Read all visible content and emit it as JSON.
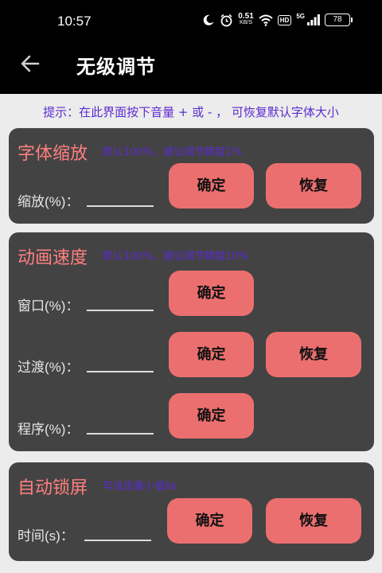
{
  "statusbar": {
    "time": "10:57",
    "net_speed_value": "0.51",
    "net_speed_unit": "KB/S",
    "hd_label": "HD",
    "signal_label": "5G",
    "battery": "78",
    "icons": [
      "moon-icon",
      "alarm-icon",
      "wifi-icon",
      "signal-icon",
      "battery-icon"
    ]
  },
  "appbar": {
    "title": "无级调节",
    "back_icon": "arrow-left-icon"
  },
  "hint": "提示：在此界面按下音量 + 或 - ， 可恢复默认字体大小",
  "colors": {
    "accent_title": "#ff7f7f",
    "hint_text": "#5b2bd0",
    "button": "#ec6f6f",
    "card_bg": "#434343"
  },
  "font_scale": {
    "title": "字体缩放",
    "subtitle": "默认100%，建议调节精度1%",
    "scale_label": "缩放(%)：",
    "confirm": "确定",
    "restore": "恢复"
  },
  "animation_speed": {
    "title": "动画速度",
    "subtitle": "默认100%，建议调节精度10%",
    "window_label": "窗口(%)：",
    "transition_label": "过渡(%)：",
    "program_label": "程序(%)：",
    "confirm_window": "确定",
    "confirm_transition": "确定",
    "restore_transition": "恢复",
    "confirm_program": "确定"
  },
  "auto_lock": {
    "title": "自动锁屏",
    "subtitle": "可设定最小值6s",
    "time_label": "时间(s)：",
    "confirm": "确定",
    "restore": "恢复"
  }
}
